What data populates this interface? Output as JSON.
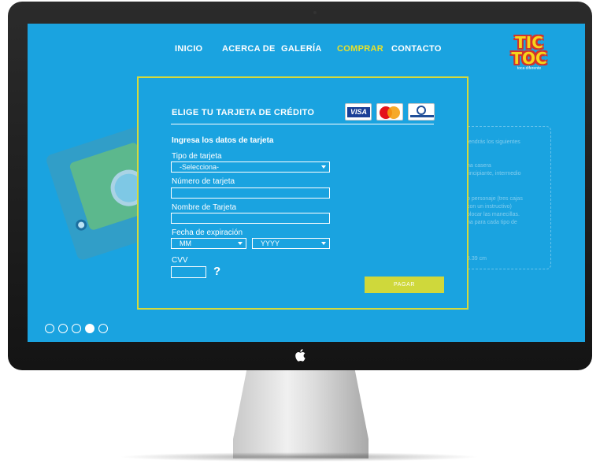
{
  "nav": {
    "items": [
      {
        "label": "INICIO"
      },
      {
        "label": "ACERCA DE"
      },
      {
        "label": "GALERÍA"
      },
      {
        "label": "COMPRAR",
        "active": true
      },
      {
        "label": "CONTACTO"
      }
    ]
  },
  "logo": {
    "line1": "TIC",
    "line2": "TOC",
    "tagline": "toca diferente"
  },
  "background_text": [
    "tendrás los siguientes",
    "na casera",
    "rincipiante, intermedio",
    "o personaje (tres cajas",
    "con un instructivo)",
    "olocar las manecillas.",
    "na para cada tipo de",
    "5.39 cm"
  ],
  "payment": {
    "title": "ELIGE TU TARJETA DE CRÉDITO",
    "card_logos": [
      "VISA",
      "MasterCard",
      "Diners Club International"
    ],
    "subtitle": "Ingresa los datos de tarjeta",
    "card_type": {
      "label": "Tipo de tarjeta",
      "value": "-Selecciona-"
    },
    "card_number": {
      "label": "Número de tarjeta",
      "value": ""
    },
    "card_name": {
      "label": "Nombre de Tarjeta",
      "value": ""
    },
    "expiration": {
      "label": "Fecha de expiración",
      "month": "MM",
      "year": "YYYY"
    },
    "cvv": {
      "label": "CVV",
      "value": "",
      "help": "?"
    },
    "pay_label": "PAGAR"
  },
  "slider": {
    "count": 5,
    "active_index": 3
  },
  "colors": {
    "screen_bg": "#1aa3e0",
    "accent": "#d6d93c",
    "active_nav": "#e8e12a",
    "pay_button": "#cfd83b"
  }
}
